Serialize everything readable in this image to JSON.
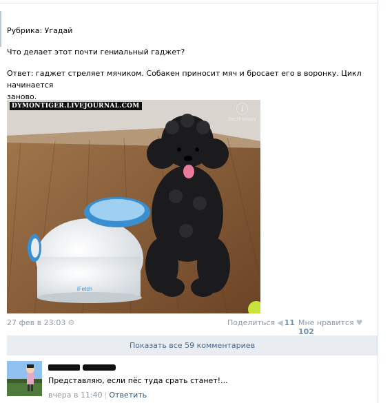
{
  "post": {
    "line1": "Рубрика: Угадай",
    "line2": "Что делает этот почти гениальный гаджет?",
    "line3": "Ответ: гаджет стреляет мячиком. Собакен приносит мяч и бросает его в воронку. Цикл начинается",
    "line4": "заново.",
    "image_watermark": "DYMONTIGER.LIVEJOURNAL.COM",
    "image_logo": "itechnology",
    "device_brand": "iFetch"
  },
  "meta": {
    "date": "27 фев в 23:03",
    "share_label": "Поделиться",
    "share_count": "11",
    "like_label": "Мне нравится",
    "like_count": "102"
  },
  "show_comments_label": "Показать все 59 комментариев",
  "comment": {
    "text": "Представляю, если пёс туда срать станет!...",
    "time": "вчера в 11:40",
    "reply_label": "Ответить"
  },
  "icons": {
    "gear": "gear-icon",
    "share": "megaphone-icon",
    "like": "heart-icon"
  },
  "colors": {
    "link": "#45688e",
    "muted": "#8c97a3",
    "button_bg": "#e9edf1"
  }
}
